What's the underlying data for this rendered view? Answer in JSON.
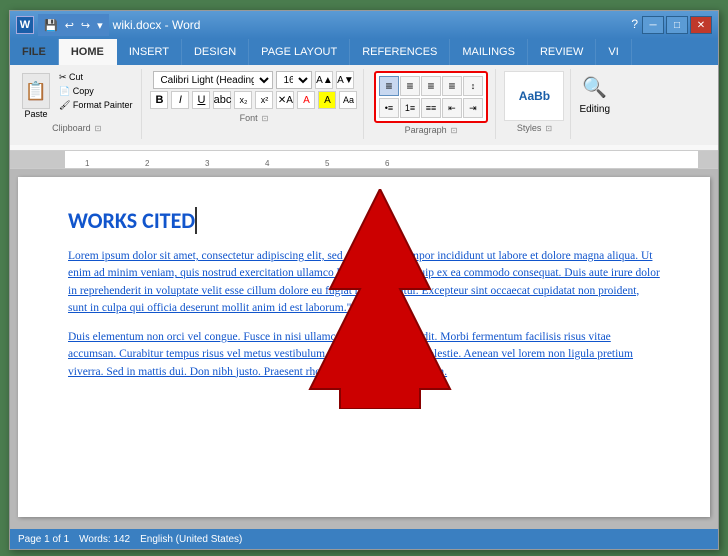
{
  "titlebar": {
    "filename": "wiki.docx - Word",
    "help_btn": "?",
    "min_btn": "─",
    "max_btn": "□",
    "close_btn": "✕"
  },
  "quickaccess": {
    "save_label": "💾",
    "undo_label": "↩",
    "redo_label": "↪",
    "dropdown_label": "▾"
  },
  "tabs": [
    {
      "label": "FILE",
      "active": false
    },
    {
      "label": "HOME",
      "active": true
    },
    {
      "label": "INSERT",
      "active": false
    },
    {
      "label": "DESIGN",
      "active": false
    },
    {
      "label": "PAGE LAYOUT",
      "active": false
    },
    {
      "label": "REFERENCES",
      "active": false
    },
    {
      "label": "MAILINGS",
      "active": false
    },
    {
      "label": "REVIEW",
      "active": false
    },
    {
      "label": "VI",
      "active": false
    }
  ],
  "ribbon": {
    "font_name": "Calibri Light (Headings)",
    "font_size": "16",
    "bold": "B",
    "italic": "I",
    "underline": "U",
    "strikethrough": "abc",
    "subscript": "x₂",
    "superscript": "x²",
    "align_left": "≡",
    "align_center": "≡",
    "align_right": "≡",
    "align_justify": "≡",
    "styles_label": "Styles",
    "editing_label": "Editing",
    "clipboard_label": "Clipboard",
    "font_label": "Font",
    "paragraph_label": "Paragraph"
  },
  "document": {
    "works_cited": "WORKS CITED",
    "paragraph1": "Lorem ipsum dolor sit amet, consectetur adipiscing elit, sed do eiusmod tempor incididunt ut labore et dolore magna aliqua. Ut enim ad minim veniam, quis nostrud exercitation ullamco laboris nisi ut aliquip ex ea commodo consequat. Duis aute irure dolor in reprehenderit in voluptate velit esse cillum dolore eu fugiat nulla pariatur. Excepteur sint occaecat cupidatat non proident, sunt in culpa qui officia deserunt mollit anim id est laborum.\".",
    "paragraph2": "Duis elementum non orci vel congue. Fusce in nisi ullamcorper, gravida blandit. Morbi fermentum facilisis risus vitae accumsan. Curabitur tempus risus vel metus vestibulum, quis suscipit purus molestie. Aenean vel lorem non ligula pretium viverra. Sed in mattis dui. Don nibh justo. Praesent rhoncus magna sit amet lorem."
  },
  "statusbar": {
    "page": "Page 1 of 1",
    "words": "Words: 142",
    "language": "English (United States)"
  }
}
